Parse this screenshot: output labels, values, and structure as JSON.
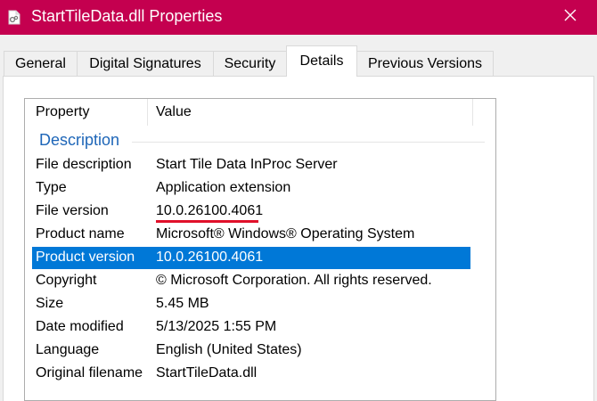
{
  "window": {
    "title": "StartTileData.dll Properties",
    "app_icon": "file-properties-icon",
    "close_icon": "close-icon",
    "accent_color": "#c4004f"
  },
  "tabs": [
    {
      "label": "General"
    },
    {
      "label": "Digital Signatures"
    },
    {
      "label": "Security"
    },
    {
      "label": "Details",
      "active": true
    },
    {
      "label": "Previous Versions"
    }
  ],
  "details": {
    "header": {
      "property": "Property",
      "value": "Value"
    },
    "group_label": "Description",
    "rows": [
      {
        "property": "File description",
        "value": "Start Tile Data InProc Server"
      },
      {
        "property": "Type",
        "value": "Application extension"
      },
      {
        "property": "File version",
        "value": "10.0.26100.4061"
      },
      {
        "property": "Product name",
        "value": "Microsoft® Windows® Operating System"
      },
      {
        "property": "Product version",
        "value": "10.0.26100.4061",
        "selected": true
      },
      {
        "property": "Copyright",
        "value": "© Microsoft Corporation. All rights reserved."
      },
      {
        "property": "Size",
        "value": "5.45 MB"
      },
      {
        "property": "Date modified",
        "value": "5/13/2025 1:55 PM"
      },
      {
        "property": "Language",
        "value": "English (United States)"
      },
      {
        "property": "Original filename",
        "value": "StartTileData.dll"
      }
    ],
    "selection_color": "#0078d7",
    "annotation_color": "#e0102a"
  }
}
